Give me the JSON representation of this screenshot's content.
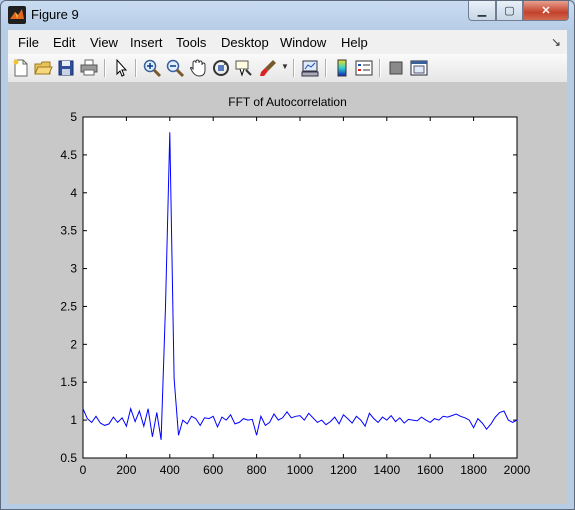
{
  "window": {
    "title": "Figure 9"
  },
  "menubar": {
    "items": [
      "File",
      "Edit",
      "View",
      "Insert",
      "Tools",
      "Desktop",
      "Window",
      "Help"
    ]
  },
  "toolbar": {
    "buttons": [
      "new-figure",
      "open-file",
      "save-figure",
      "print-figure",
      "edit-plot",
      "zoom-in",
      "zoom-out",
      "pan",
      "rotate-3d",
      "data-cursor",
      "brush",
      "link-plot",
      "insert-colorbar",
      "insert-legend",
      "hide-plot-tools",
      "show-plot-tools"
    ]
  },
  "chart_data": {
    "type": "line",
    "title": "FFT of Autocorrelation",
    "xlabel": "",
    "ylabel": "",
    "xlim": [
      0,
      2000
    ],
    "ylim": [
      0.5,
      5
    ],
    "xticks": [
      0,
      200,
      400,
      600,
      800,
      1000,
      1200,
      1400,
      1600,
      1800,
      2000
    ],
    "yticks": [
      0.5,
      1,
      1.5,
      2,
      2.5,
      3,
      3.5,
      4,
      4.5,
      5
    ],
    "line_color": "#0000ff",
    "grid": false,
    "series": [
      {
        "x": [
          0,
          20,
          40,
          60,
          80,
          100,
          120,
          140,
          160,
          180,
          200,
          220,
          240,
          260,
          280,
          300,
          320,
          340,
          360,
          380,
          400,
          420,
          440,
          460,
          480,
          500,
          520,
          540,
          560,
          580,
          600,
          620,
          640,
          660,
          680,
          700,
          720,
          740,
          760,
          780,
          800,
          820,
          840,
          860,
          880,
          900,
          920,
          940,
          960,
          980,
          1000,
          1020,
          1040,
          1060,
          1080,
          1100,
          1120,
          1140,
          1160,
          1180,
          1200,
          1220,
          1240,
          1260,
          1280,
          1300,
          1320,
          1340,
          1360,
          1380,
          1400,
          1420,
          1440,
          1460,
          1480,
          1500,
          1520,
          1540,
          1560,
          1580,
          1600,
          1620,
          1640,
          1660,
          1680,
          1700,
          1720,
          1740,
          1760,
          1780,
          1800,
          1820,
          1840,
          1860,
          1880,
          1900,
          1920,
          1940,
          1960,
          1980,
          2000
        ],
        "y": [
          1.15,
          1.02,
          0.97,
          1.05,
          0.96,
          0.93,
          0.95,
          1.04,
          0.97,
          1.03,
          0.92,
          1.15,
          0.98,
          1.12,
          0.92,
          1.15,
          0.78,
          1.1,
          0.74,
          2.5,
          4.8,
          1.55,
          0.8,
          1.0,
          0.95,
          1.05,
          1.02,
          0.93,
          1.03,
          1.02,
          1.05,
          0.91,
          1.04,
          1.0,
          1.07,
          0.95,
          0.97,
          1.02,
          1.0,
          1.01,
          0.8,
          1.05,
          0.93,
          0.97,
          1.08,
          1.0,
          1.03,
          1.11,
          1.03,
          1.05,
          1.06,
          1.0,
          1.09,
          1.03,
          0.97,
          1.0,
          0.94,
          0.98,
          1.04,
          0.95,
          1.07,
          1.02,
          0.96,
          1.05,
          1.0,
          0.92,
          1.09,
          1.02,
          0.97,
          1.04,
          1.0,
          1.06,
          0.98,
          1.03,
          0.96,
          1.01,
          1.0,
          0.99,
          1.04,
          1.0,
          0.97,
          1.02,
          1.0,
          1.05,
          1.04,
          1.06,
          1.08,
          1.05,
          1.03,
          1.0,
          0.9,
          1.02,
          0.96,
          0.88,
          0.95,
          1.04,
          1.1,
          1.12,
          1.0,
          0.97,
          1.0
        ]
      }
    ]
  }
}
